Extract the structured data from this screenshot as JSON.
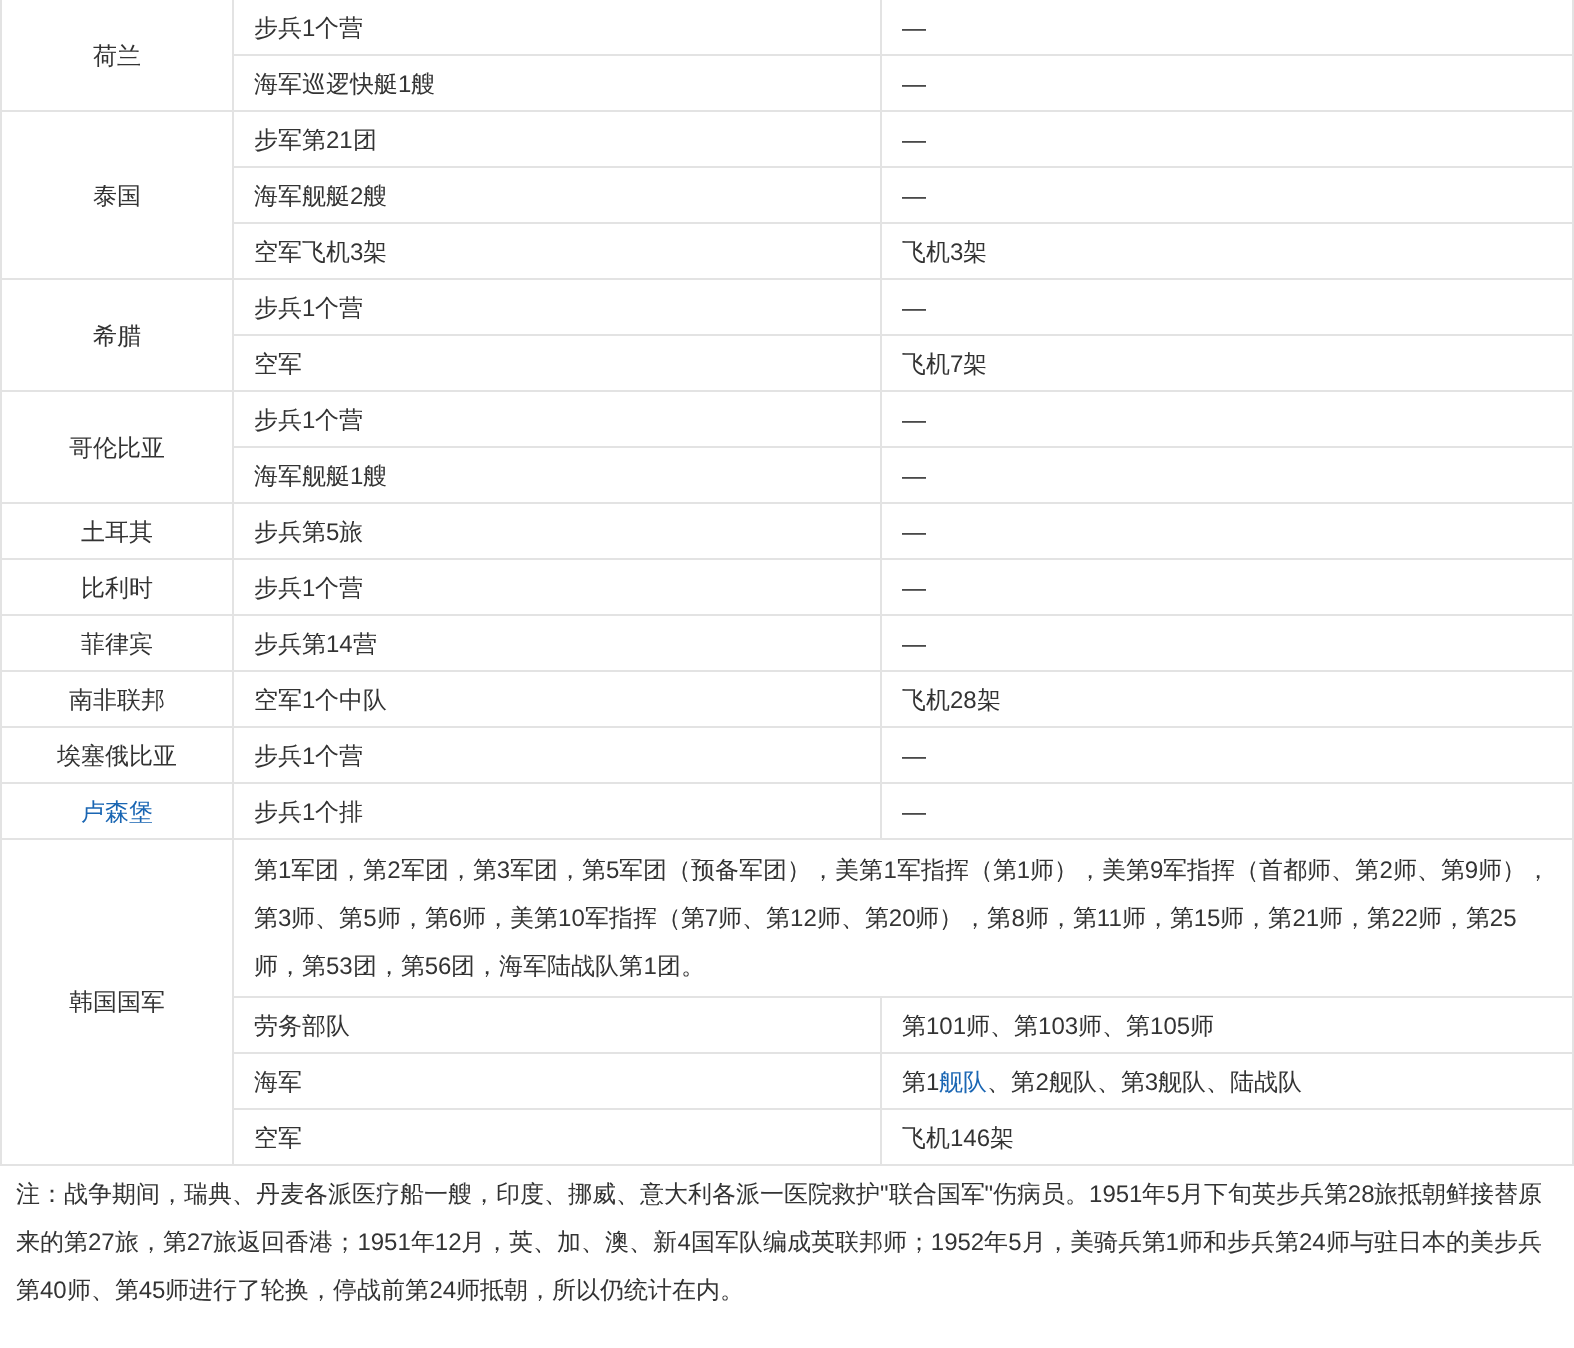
{
  "table": {
    "rows": [
      {
        "country": "荷兰",
        "units": [
          {
            "unit": "步兵1个营",
            "detail": "—"
          },
          {
            "unit": "海军巡逻快艇1艘",
            "detail": "—"
          }
        ]
      },
      {
        "country": "泰国",
        "units": [
          {
            "unit": "步军第21团",
            "detail": "—"
          },
          {
            "unit": "海军舰艇2艘",
            "detail": "—"
          },
          {
            "unit": "空军飞机3架",
            "detail": "飞机3架"
          }
        ]
      },
      {
        "country": "希腊",
        "units": [
          {
            "unit": "步兵1个营",
            "detail": "—"
          },
          {
            "unit": "空军",
            "detail": "飞机7架"
          }
        ]
      },
      {
        "country": "哥伦比亚",
        "units": [
          {
            "unit": "步兵1个营",
            "detail": "—"
          },
          {
            "unit": "海军舰艇1艘",
            "detail": "—"
          }
        ]
      },
      {
        "country": "土耳其",
        "units": [
          {
            "unit": "步兵第5旅",
            "detail": "—"
          }
        ]
      },
      {
        "country": "比利时",
        "units": [
          {
            "unit": "步兵1个营",
            "detail": "—"
          }
        ]
      },
      {
        "country": "菲律宾",
        "units": [
          {
            "unit": "步兵第14营",
            "detail": "—"
          }
        ]
      },
      {
        "country": "南非联邦",
        "units": [
          {
            "unit": "空军1个中队",
            "detail": "飞机28架"
          }
        ]
      },
      {
        "country": "埃塞俄比亚",
        "units": [
          {
            "unit": "步兵1个营",
            "detail": "—"
          }
        ]
      },
      {
        "country": "卢森堡",
        "link": true,
        "units": [
          {
            "unit": "步兵1个排",
            "detail": "—"
          }
        ]
      },
      {
        "country": "韩国国军",
        "units": [
          {
            "kind": "wide",
            "unit": "第1军团，第2军团，第3军团，第5军团（预备军团），美第1军指挥（第1师），美第9军指挥（首都师、第2师、第9师），第3师、第5师，第6师，美第10军指挥（第7师、第12师、第20师），第8师，第11师，第15师，第21师，第22师，第25师，第53团，第56团，海军陆战队第1团。"
          },
          {
            "unit": "劳务部队",
            "detail": "第101师、第103师、第105师"
          },
          {
            "unit": "海军",
            "detail_parts": [
              {
                "text": "第1"
              },
              {
                "text": "舰队",
                "link": true
              },
              {
                "text": "、第2舰队、第3舰队、陆战队"
              }
            ]
          },
          {
            "unit": "空军",
            "detail": "飞机146架"
          }
        ]
      }
    ]
  },
  "note": "注：战争期间，瑞典、丹麦各派医疗船一艘，印度、挪威、意大利各派一医院救护\"联合国军\"伤病员。1951年5月下旬英步兵第28旅抵朝鲜接替原来的第27旅，第27旅返回香港；1951年12月，英、加、澳、新4国军队编成英联邦师；1952年5月，美骑兵第1师和步兵第24师与驻日本的美步兵第40师、第45师进行了轮换，停战前第24师抵朝，所以仍统计在内。"
}
